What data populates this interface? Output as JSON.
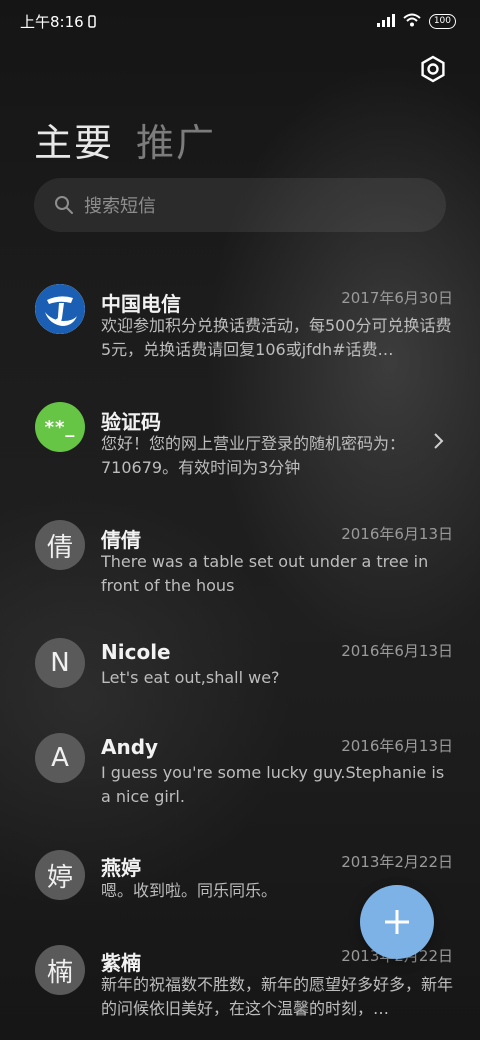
{
  "status_bar": {
    "time": "上午8:16",
    "battery": "100"
  },
  "header": {
    "tabs": [
      {
        "label": "主要"
      },
      {
        "label": "推广"
      }
    ]
  },
  "search": {
    "placeholder": "搜索短信"
  },
  "messages": [
    {
      "name": "中国电信",
      "date": "2017年6月30日",
      "preview": "欢迎参加积分兑换话费活动，每500分可兑换话费5元，兑换话费请回复106或jfdh#话费…",
      "avatar": "telecom-logo"
    },
    {
      "name": "验证码",
      "date": "",
      "preview": "您好！您的网上营业厅登录的随机密码为：710679。有效时间为3分钟",
      "avatar": "**_"
    },
    {
      "name": "倩倩",
      "date": "2016年6月13日",
      "preview": "There was a table set out under a tree in front of the hous",
      "avatar": "倩"
    },
    {
      "name": "Nicole",
      "date": "2016年6月13日",
      "preview": "Let's eat out,shall we?",
      "avatar": "N"
    },
    {
      "name": "Andy",
      "date": "2016年6月13日",
      "preview": "I guess you're some lucky guy.Stephanie is a nice girl.",
      "avatar": "A"
    },
    {
      "name": "燕婷",
      "date": "2013年2月22日",
      "preview": "嗯。收到啦。同乐同乐。",
      "avatar": "婷"
    },
    {
      "name": "紫楠",
      "date": "2013年2月22日",
      "preview": "新年的祝福数不胜数，新年的愿望好多好多，新年的问候依旧美好，在这个温馨的时刻，…",
      "avatar": "楠"
    }
  ],
  "colors": {
    "fab": "#7cb2e6",
    "verification_avatar": "#66c545",
    "telecom_blue": "#1a5fb4"
  }
}
